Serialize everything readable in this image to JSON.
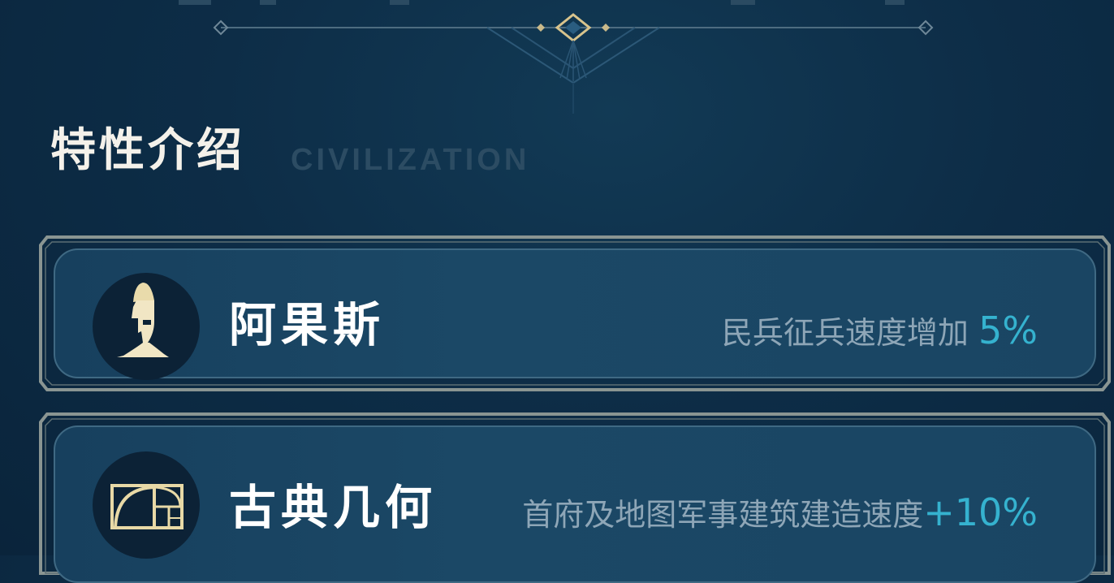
{
  "section": {
    "title": "特性介绍",
    "subtitle": "CIVILIZATION"
  },
  "traits": [
    {
      "name": "阿果斯",
      "icon": "spartan-helmet-icon",
      "description": "民兵征兵速度增加 ",
      "value": "5%"
    },
    {
      "name": "古典几何",
      "icon": "golden-ratio-icon",
      "description": "首府及地图军事建筑建造速度",
      "value": "+10%"
    }
  ],
  "colors": {
    "background": "#0d2d47",
    "accent": "#35b2cf",
    "gold": "#e8d9a6",
    "frame": "#8a9592"
  }
}
